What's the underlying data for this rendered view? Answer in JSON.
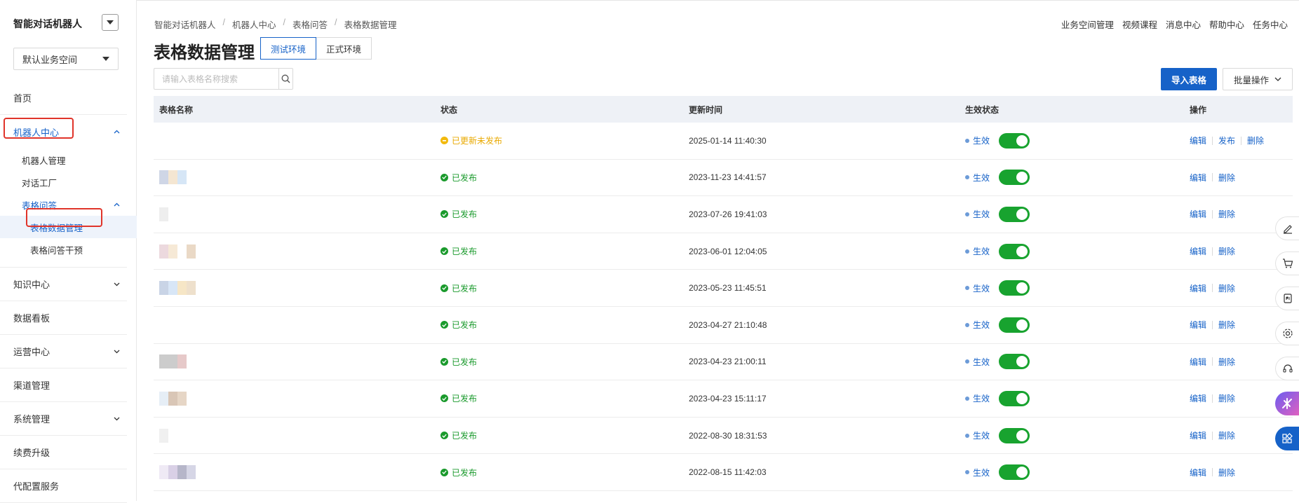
{
  "app": {
    "title": "智能对话机器人"
  },
  "workspace": {
    "selected": "默认业务空间"
  },
  "menu": {
    "home": "首页",
    "robot_center": "机器人中心",
    "robot_manage": "机器人管理",
    "dialog_factory": "对话工厂",
    "table_qa": "表格问答",
    "table_data": "表格数据管理",
    "table_intervene": "表格问答干预",
    "knowledge": "知识中心",
    "dashboard": "数据看板",
    "operation": "运营中心",
    "channel": "渠道管理",
    "system": "系统管理",
    "renew": "续费升级",
    "config_service": "代配置服务"
  },
  "breadcrumb": [
    "智能对话机器人",
    "机器人中心",
    "表格问答",
    "表格数据管理"
  ],
  "top_links": [
    "业务空间管理",
    "视频课程",
    "消息中心",
    "帮助中心",
    "任务中心"
  ],
  "page": {
    "title": "表格数据管理",
    "env_tabs": [
      "测试环境",
      "正式环境"
    ],
    "search_placeholder": "请输入表格名称搜索",
    "import_label": "导入表格",
    "batch_label": "批量操作"
  },
  "table": {
    "headers": [
      "表格名称",
      "状态",
      "更新时间",
      "生效状态",
      "操作"
    ],
    "rows": [
      {
        "status": "已更新未发布",
        "status_type": "warn",
        "time": "2025-01-14 11:40:30",
        "effect": "生效",
        "ops": [
          "编辑",
          "发布",
          "删除"
        ]
      },
      {
        "status": "已发布",
        "status_type": "ok",
        "time": "2023-11-23 14:41:57",
        "effect": "生效",
        "ops": [
          "编辑",
          "删除"
        ]
      },
      {
        "status": "已发布",
        "status_type": "ok",
        "time": "2023-07-26 19:41:03",
        "effect": "生效",
        "ops": [
          "编辑",
          "删除"
        ]
      },
      {
        "status": "已发布",
        "status_type": "ok",
        "time": "2023-06-01 12:04:05",
        "effect": "生效",
        "ops": [
          "编辑",
          "删除"
        ]
      },
      {
        "status": "已发布",
        "status_type": "ok",
        "time": "2023-05-23 11:45:51",
        "effect": "生效",
        "ops": [
          "编辑",
          "删除"
        ]
      },
      {
        "status": "已发布",
        "status_type": "ok",
        "time": "2023-04-27 21:10:48",
        "effect": "生效",
        "ops": [
          "编辑",
          "删除"
        ]
      },
      {
        "status": "已发布",
        "status_type": "ok",
        "time": "2023-04-23 21:00:11",
        "effect": "生效",
        "ops": [
          "编辑",
          "删除"
        ]
      },
      {
        "status": "已发布",
        "status_type": "ok",
        "time": "2023-04-23 15:11:17",
        "effect": "生效",
        "ops": [
          "编辑",
          "删除"
        ]
      },
      {
        "status": "已发布",
        "status_type": "ok",
        "time": "2022-08-30 18:31:53",
        "effect": "生效",
        "ops": [
          "编辑",
          "删除"
        ]
      },
      {
        "status": "已发布",
        "status_type": "ok",
        "time": "2022-08-15 11:42:03",
        "effect": "生效",
        "ops": [
          "编辑",
          "删除"
        ]
      }
    ]
  },
  "float_icons": [
    "edit-icon",
    "cart-icon",
    "api-icon",
    "settings-icon",
    "headset-icon",
    "ai-assistant-icon",
    "apps-icon"
  ],
  "colors": {
    "primary": "#1662c8",
    "success": "#1a9a2c",
    "warning": "#f2b90c",
    "highlight": "#e0342a"
  }
}
